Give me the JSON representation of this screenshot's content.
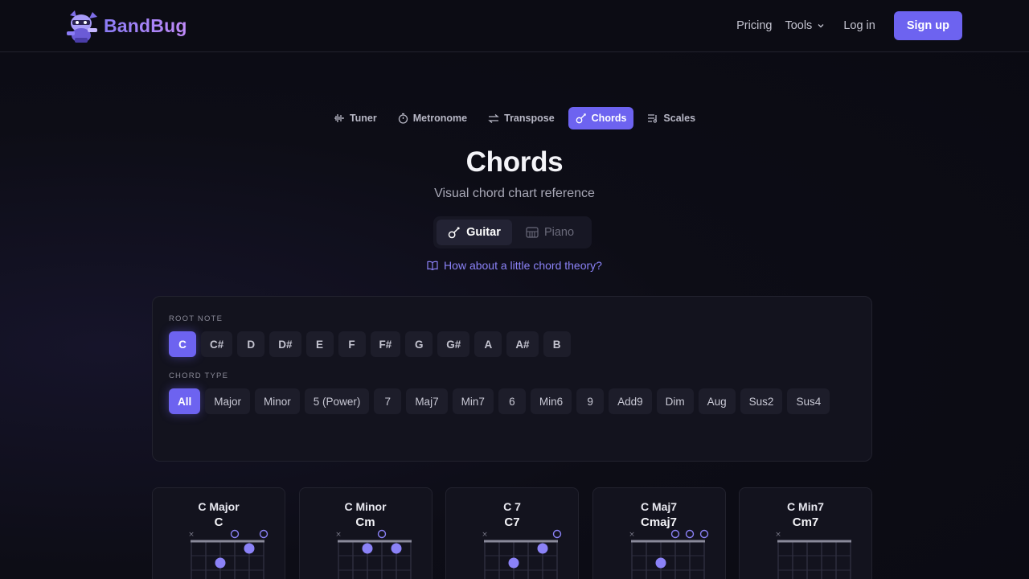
{
  "brand": {
    "name": "BandBug",
    "accent": "#6d63f0"
  },
  "nav": {
    "pricing": "Pricing",
    "tools": "Tools",
    "login": "Log in",
    "signup": "Sign up"
  },
  "tool_tabs": [
    {
      "label": "Tuner",
      "icon": "waveform-icon",
      "active": false
    },
    {
      "label": "Metronome",
      "icon": "stopwatch-icon",
      "active": false
    },
    {
      "label": "Transpose",
      "icon": "swap-arrows-icon",
      "active": false
    },
    {
      "label": "Chords",
      "icon": "guitar-icon",
      "active": true
    },
    {
      "label": "Scales",
      "icon": "scales-list-icon",
      "active": false
    }
  ],
  "page": {
    "title": "Chords",
    "subtitle": "Visual chord chart reference",
    "theory_link": "How about a little chord theory?"
  },
  "instrument": {
    "guitar": "Guitar",
    "piano": "Piano",
    "selected": "Guitar"
  },
  "filters": {
    "root_label": "ROOT NOTE",
    "root_notes": [
      "C",
      "C#",
      "D",
      "D#",
      "E",
      "F",
      "F#",
      "G",
      "G#",
      "A",
      "A#",
      "B"
    ],
    "root_selected": "C",
    "type_label": "CHORD TYPE",
    "chord_types": [
      "All",
      "Major",
      "Minor",
      "5 (Power)",
      "7",
      "Maj7",
      "Min7",
      "6",
      "Min6",
      "9",
      "Add9",
      "Dim",
      "Aug",
      "Sus2",
      "Sus4"
    ],
    "type_selected": "All"
  },
  "chords": [
    {
      "name": "C Major",
      "symbol": "C",
      "muted": [
        0
      ],
      "open": [
        3,
        5
      ],
      "dots": [
        {
          "string": 4,
          "fret": 1
        },
        {
          "string": 2,
          "fret": 2
        }
      ]
    },
    {
      "name": "C Minor",
      "symbol": "Cm",
      "muted": [
        0
      ],
      "open": [
        3
      ],
      "dots": [
        {
          "string": 2,
          "fret": 1
        },
        {
          "string": 4,
          "fret": 1
        }
      ]
    },
    {
      "name": "C 7",
      "symbol": "C7",
      "muted": [
        0
      ],
      "open": [
        5
      ],
      "dots": [
        {
          "string": 4,
          "fret": 1
        },
        {
          "string": 2,
          "fret": 2
        }
      ]
    },
    {
      "name": "C Maj7",
      "symbol": "Cmaj7",
      "muted": [
        0
      ],
      "open": [
        3,
        4,
        5
      ],
      "dots": [
        {
          "string": 2,
          "fret": 2
        }
      ]
    },
    {
      "name": "C Min7",
      "symbol": "Cm7",
      "muted": [
        0
      ],
      "open": [],
      "dots": []
    }
  ]
}
